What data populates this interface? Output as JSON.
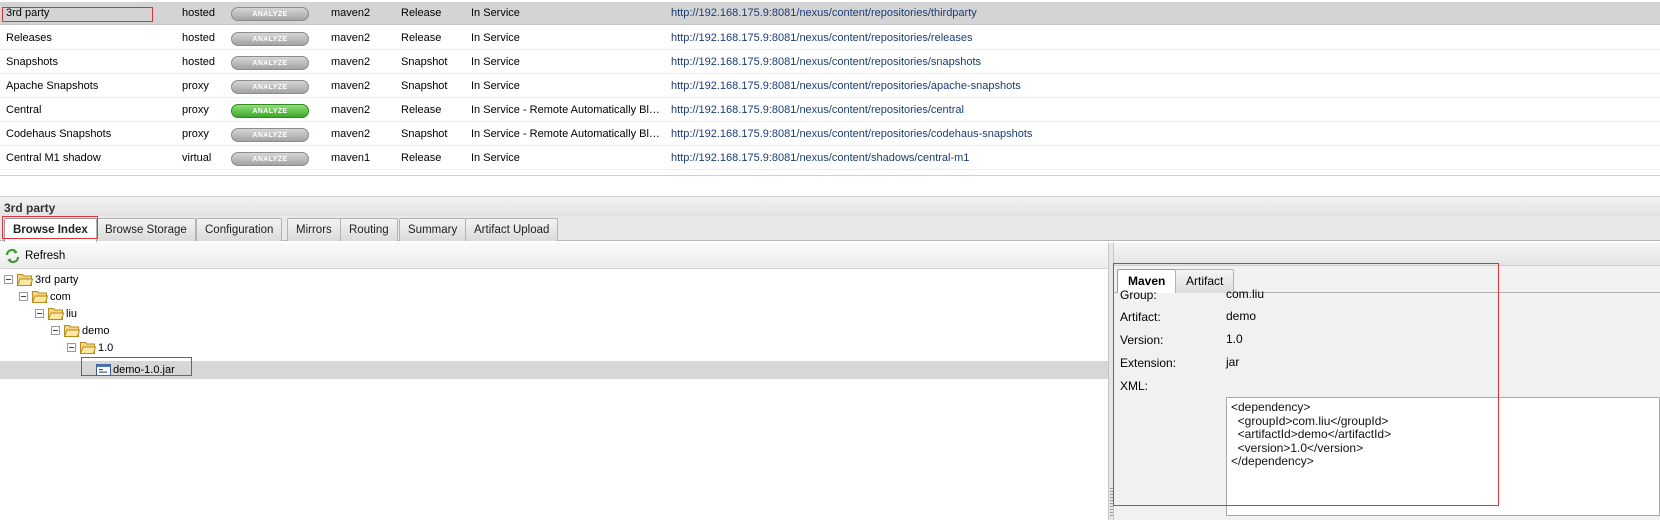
{
  "repositories": [
    {
      "name": "3rd party",
      "type": "hosted",
      "analyze": "ANALYZE",
      "analyze_active": false,
      "format": "maven2",
      "policy": "Release",
      "status": "In Service",
      "url": "http://192.168.175.9:8081/nexus/content/repositories/thirdparty"
    },
    {
      "name": "Releases",
      "type": "hosted",
      "analyze": "ANALYZE",
      "analyze_active": false,
      "format": "maven2",
      "policy": "Release",
      "status": "In Service",
      "url": "http://192.168.175.9:8081/nexus/content/repositories/releases"
    },
    {
      "name": "Snapshots",
      "type": "hosted",
      "analyze": "ANALYZE",
      "analyze_active": false,
      "format": "maven2",
      "policy": "Snapshot",
      "status": "In Service",
      "url": "http://192.168.175.9:8081/nexus/content/repositories/snapshots"
    },
    {
      "name": "Apache Snapshots",
      "type": "proxy",
      "analyze": "ANALYZE",
      "analyze_active": false,
      "format": "maven2",
      "policy": "Snapshot",
      "status": "In Service",
      "url": "http://192.168.175.9:8081/nexus/content/repositories/apache-snapshots"
    },
    {
      "name": "Central",
      "type": "proxy",
      "analyze": "ANALYZE",
      "analyze_active": true,
      "format": "maven2",
      "policy": "Release",
      "status": "In Service - Remote Automatically Blo...",
      "url": "http://192.168.175.9:8081/nexus/content/repositories/central"
    },
    {
      "name": "Codehaus Snapshots",
      "type": "proxy",
      "analyze": "ANALYZE",
      "analyze_active": false,
      "format": "maven2",
      "policy": "Snapshot",
      "status": "In Service - Remote Automatically Blo...",
      "url": "http://192.168.175.9:8081/nexus/content/repositories/codehaus-snapshots"
    },
    {
      "name": "Central M1 shadow",
      "type": "virtual",
      "analyze": "ANALYZE",
      "analyze_active": false,
      "format": "maven1",
      "policy": "Release",
      "status": "In Service",
      "url": "http://192.168.175.9:8081/nexus/content/shadows/central-m1"
    }
  ],
  "panel": {
    "title": "3rd party",
    "tabs": [
      "Browse Index",
      "Browse Storage",
      "Configuration",
      "Mirrors",
      "Routing",
      "Summary",
      "Artifact Upload"
    ],
    "active_tab": "Browse Index"
  },
  "tree": {
    "refresh_label": "Refresh",
    "nodes": [
      {
        "label": "3rd party",
        "kind": "folder"
      },
      {
        "label": "com",
        "kind": "folder"
      },
      {
        "label": "liu",
        "kind": "folder"
      },
      {
        "label": "demo",
        "kind": "folder"
      },
      {
        "label": "1.0",
        "kind": "folder"
      },
      {
        "label": "demo-1.0.jar",
        "kind": "file",
        "selected": true
      }
    ]
  },
  "detail": {
    "tabs": [
      "Maven",
      "Artifact"
    ],
    "active_tab": "Maven",
    "fields": [
      {
        "label": "Group:",
        "value": "com.liu"
      },
      {
        "label": "Artifact:",
        "value": "demo"
      },
      {
        "label": "Version:",
        "value": "1.0"
      },
      {
        "label": "Extension:",
        "value": "jar"
      }
    ],
    "xml_label": "XML:",
    "xml": "<dependency>\n  <groupId>com.liu</groupId>\n  <artifactId>demo</artifactId>\n  <version>1.0</version>\n</dependency>"
  },
  "colors": {
    "highlight": "#e0323a",
    "selected_row": "#d4d4d4",
    "link": "#1a3d75",
    "analyze_active": "#3fa82a"
  }
}
